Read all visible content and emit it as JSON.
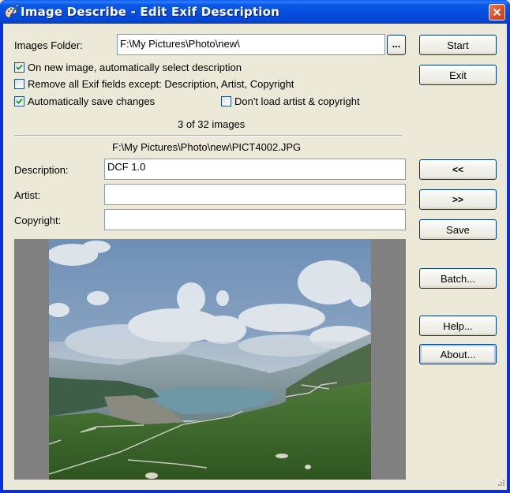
{
  "window": {
    "title": "Image Describe - Edit Exif Description",
    "app_icon": "palette-icon",
    "close_icon": "close-icon",
    "titlebar_color": "#0550E0",
    "close_color": "#D8532C"
  },
  "folder": {
    "label": "Images Folder:",
    "value": "F:\\My Pictures\\Photo\\new\\",
    "browse_label": "..."
  },
  "options": [
    {
      "label": "On new image, automatically select description",
      "checked": true
    },
    {
      "label": "Remove all Exif fields except: Description, Artist, Copyright",
      "checked": false
    },
    {
      "label": "Automatically save changes",
      "checked": true
    },
    {
      "label": "Don't load artist & copyright",
      "checked": false
    }
  ],
  "status": {
    "counter": "3 of 32 images",
    "current_file": "F:\\My Pictures\\Photo\\new\\PICT4002.JPG"
  },
  "fields": {
    "description": {
      "label": "Description:",
      "value": "DCF 1.0"
    },
    "artist": {
      "label": "Artist:",
      "value": ""
    },
    "copyright": {
      "label": "Copyright:",
      "value": ""
    }
  },
  "buttons": {
    "start": "Start",
    "exit": "Exit",
    "prev": "<<",
    "next": ">>",
    "save": "Save",
    "batch": "Batch...",
    "help": "Help...",
    "about": "About..."
  },
  "preview": {
    "subject": "Mountain landscape with lake, clouds and winding roads",
    "background_color": "#808080"
  }
}
